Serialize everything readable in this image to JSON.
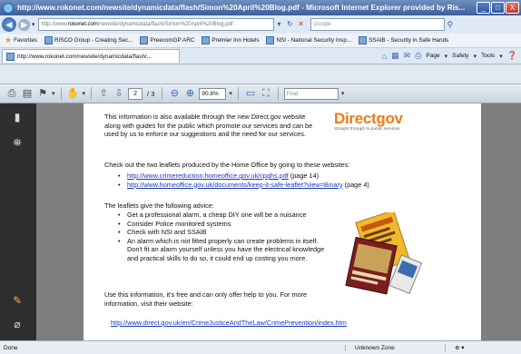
{
  "window": {
    "title": "http://www.rokonet.com/newsite/dynamicdata/flash/Simon%20April%20Blog.pdf - Microsoft Internet Explorer provided by Ris...",
    "minimize": "_",
    "maximize": "□",
    "close": "X"
  },
  "address": {
    "prefix": "http://www.",
    "domain": "rokonet.com",
    "rest": "/newsite/dynamicdata/flash/Simon%20April%20Blog.pdf",
    "search_placeholder": "Google"
  },
  "favorites": {
    "label": "Favorites",
    "items": [
      "RISCO Group - Creating Sec...",
      "PreecomGP ARC",
      "Premier Inn Hotels",
      "NSI - National Security Insp...",
      "SSAIB - Security in Safe Hands"
    ]
  },
  "tab": {
    "label": "http://www.rokonet.com/newsite/dynamicdata/flash/..."
  },
  "commandbar": {
    "page": "Page",
    "safety": "Safety",
    "tools": "Tools"
  },
  "pdf_toolbar": {
    "page_current": "2",
    "page_total": "/ 3",
    "zoom": "90.8%",
    "find_placeholder": "Find"
  },
  "document": {
    "intro": "This information is also available through the new Direct.gov website along with guides for the public which promote our services and can be used by us to enforce our suggestions and the need for our services.",
    "leaflets_intro": "Check out the two leaflets produced by the Home Office by going to these websites:",
    "links": [
      {
        "url": "http://www.crimereduction.homeoffice.gov.uk/cpghs.pdf",
        "suffix": " (page 14)"
      },
      {
        "url": "http://www.homeoffice.gov.uk/documents/keep-it-safe-leaflet?view=Binary",
        "suffix": " (page 4)"
      }
    ],
    "advice_intro": "The leaflets give the following advice:",
    "advice": [
      "Get a professional alarm, a cheap DIY one will be a nuisance",
      "Consider Police monitored systems",
      "Check with NSI and SSAIB",
      "An alarm which is not fitted properly can create problems in itself. Don't fit an alarm yourself unless you have the electrical knowledge and practical skills to do so, it could end up costing you more."
    ],
    "closing": "Use this information, it's free and can only offer help to you. For more information, visit their website:",
    "final_link": "http://www.direct.gov.uk/en/CrimeJusticeAndTheLaw/CrimePrevention/index.htm",
    "logo_word": "Directgov",
    "logo_tagline": "Straight through to public services"
  },
  "status": {
    "left": "Done",
    "zone": "Unknown Zone",
    "zoom": "⊕ ▾"
  },
  "colors": {
    "link": "#1a38c8",
    "logo_orange": "#f07b18",
    "pdf_sidebar": "#2e2e2e"
  }
}
